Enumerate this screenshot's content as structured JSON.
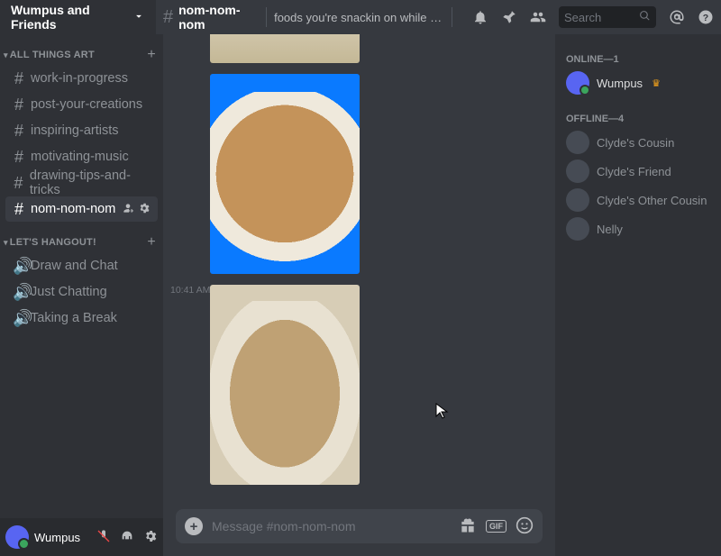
{
  "server": {
    "name": "Wumpus and Friends"
  },
  "channel": {
    "name": "nom-nom-nom",
    "topic": "foods you're snackin on while making art"
  },
  "search": {
    "placeholder": "Search"
  },
  "categories": [
    {
      "name": "ALL THINGS ART",
      "items": [
        {
          "name": "work-in-progress",
          "type": "text"
        },
        {
          "name": "post-your-creations",
          "type": "text"
        },
        {
          "name": "inspiring-artists",
          "type": "text"
        },
        {
          "name": "motivating-music",
          "type": "text"
        },
        {
          "name": "drawing-tips-and-tricks",
          "type": "text"
        },
        {
          "name": "nom-nom-nom",
          "type": "text",
          "active": true
        }
      ]
    },
    {
      "name": "LET'S HANGOUT!",
      "items": [
        {
          "name": "Draw and Chat",
          "type": "voice"
        },
        {
          "name": "Just Chatting",
          "type": "voice"
        },
        {
          "name": "Taking a Break",
          "type": "voice"
        }
      ]
    }
  ],
  "user": {
    "name": "Wumpus"
  },
  "messages": {
    "ts2": "10:41 AM"
  },
  "input": {
    "placeholder": "Message #nom-nom-nom"
  },
  "members": {
    "online_label": "ONLINE—1",
    "offline_label": "OFFLINE—4",
    "online": [
      {
        "name": "Wumpus",
        "owner": true
      }
    ],
    "offline": [
      {
        "name": "Clyde's Cousin"
      },
      {
        "name": "Clyde's Friend"
      },
      {
        "name": "Clyde's Other Cousin"
      },
      {
        "name": "Nelly"
      }
    ]
  },
  "gif_label": "GIF"
}
